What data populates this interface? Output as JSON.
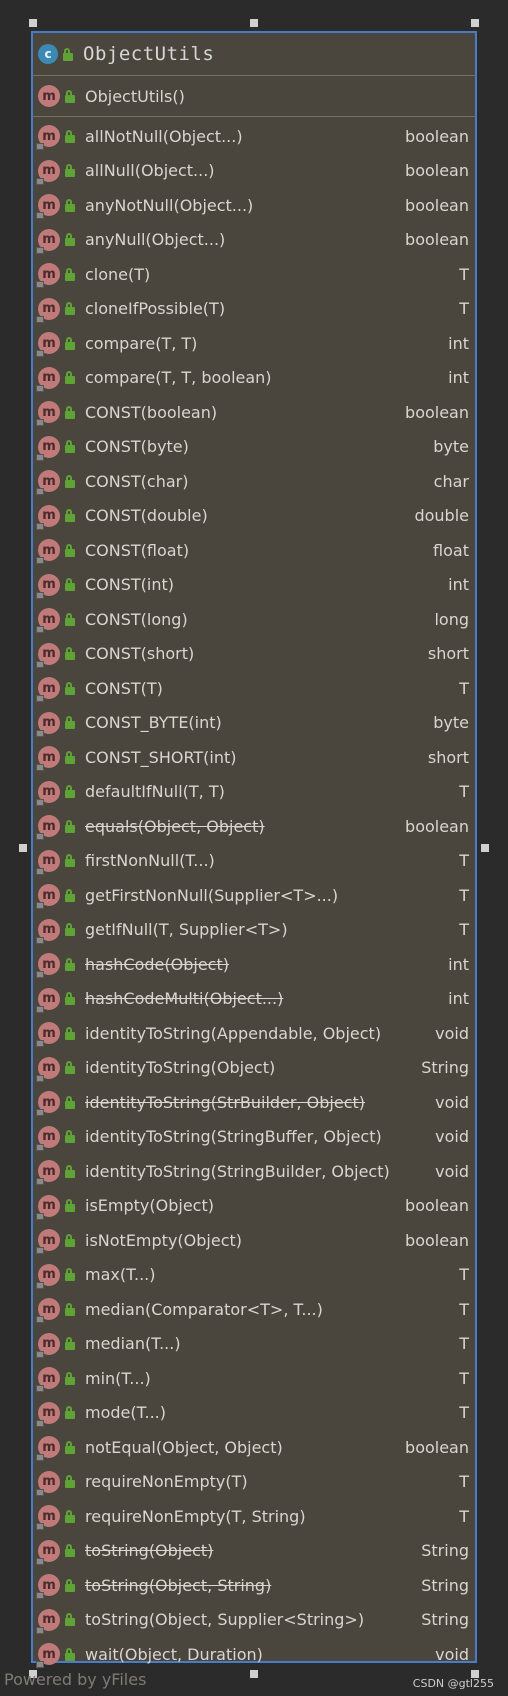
{
  "class_name": "ObjectUtils",
  "class_icon_letter": "c",
  "method_icon_letter": "m",
  "constructor": "ObjectUtils()",
  "methods": [
    {
      "name": "allNotNull(Object...)",
      "ret": "boolean",
      "deprecated": false
    },
    {
      "name": "allNull(Object...)",
      "ret": "boolean",
      "deprecated": false
    },
    {
      "name": "anyNotNull(Object...)",
      "ret": "boolean",
      "deprecated": false
    },
    {
      "name": "anyNull(Object...)",
      "ret": "boolean",
      "deprecated": false
    },
    {
      "name": "clone(T)",
      "ret": "T",
      "deprecated": false
    },
    {
      "name": "cloneIfPossible(T)",
      "ret": "T",
      "deprecated": false
    },
    {
      "name": "compare(T, T)",
      "ret": "int",
      "deprecated": false
    },
    {
      "name": "compare(T, T, boolean)",
      "ret": "int",
      "deprecated": false
    },
    {
      "name": "CONST(boolean)",
      "ret": "boolean",
      "deprecated": false
    },
    {
      "name": "CONST(byte)",
      "ret": "byte",
      "deprecated": false
    },
    {
      "name": "CONST(char)",
      "ret": "char",
      "deprecated": false
    },
    {
      "name": "CONST(double)",
      "ret": "double",
      "deprecated": false
    },
    {
      "name": "CONST(float)",
      "ret": "float",
      "deprecated": false
    },
    {
      "name": "CONST(int)",
      "ret": "int",
      "deprecated": false
    },
    {
      "name": "CONST(long)",
      "ret": "long",
      "deprecated": false
    },
    {
      "name": "CONST(short)",
      "ret": "short",
      "deprecated": false
    },
    {
      "name": "CONST(T)",
      "ret": "T",
      "deprecated": false
    },
    {
      "name": "CONST_BYTE(int)",
      "ret": "byte",
      "deprecated": false
    },
    {
      "name": "CONST_SHORT(int)",
      "ret": "short",
      "deprecated": false
    },
    {
      "name": "defaultIfNull(T, T)",
      "ret": "T",
      "deprecated": false
    },
    {
      "name": "equals(Object, Object)",
      "ret": "boolean",
      "deprecated": true
    },
    {
      "name": "firstNonNull(T...)",
      "ret": "T",
      "deprecated": false
    },
    {
      "name": "getFirstNonNull(Supplier<T>...)",
      "ret": "T",
      "deprecated": false
    },
    {
      "name": "getIfNull(T, Supplier<T>)",
      "ret": "T",
      "deprecated": false
    },
    {
      "name": "hashCode(Object)",
      "ret": "int",
      "deprecated": true
    },
    {
      "name": "hashCodeMulti(Object...)",
      "ret": "int",
      "deprecated": true
    },
    {
      "name": "identityToString(Appendable, Object)",
      "ret": "void",
      "deprecated": false
    },
    {
      "name": "identityToString(Object)",
      "ret": "String",
      "deprecated": false
    },
    {
      "name": "identityToString(StrBuilder, Object)",
      "ret": "void",
      "deprecated": true
    },
    {
      "name": "identityToString(StringBuffer, Object)",
      "ret": "void",
      "deprecated": false
    },
    {
      "name": "identityToString(StringBuilder, Object)",
      "ret": "void",
      "deprecated": false
    },
    {
      "name": "isEmpty(Object)",
      "ret": "boolean",
      "deprecated": false
    },
    {
      "name": "isNotEmpty(Object)",
      "ret": "boolean",
      "deprecated": false
    },
    {
      "name": "max(T...)",
      "ret": "T",
      "deprecated": false
    },
    {
      "name": "median(Comparator<T>, T...)",
      "ret": "T",
      "deprecated": false
    },
    {
      "name": "median(T...)",
      "ret": "T",
      "deprecated": false
    },
    {
      "name": "min(T...)",
      "ret": "T",
      "deprecated": false
    },
    {
      "name": "mode(T...)",
      "ret": "T",
      "deprecated": false
    },
    {
      "name": "notEqual(Object, Object)",
      "ret": "boolean",
      "deprecated": false
    },
    {
      "name": "requireNonEmpty(T)",
      "ret": "T",
      "deprecated": false
    },
    {
      "name": "requireNonEmpty(T, String)",
      "ret": "T",
      "deprecated": false
    },
    {
      "name": "toString(Object)",
      "ret": "String",
      "deprecated": true
    },
    {
      "name": "toString(Object, String)",
      "ret": "String",
      "deprecated": true
    },
    {
      "name": "toString(Object, Supplier<String>)",
      "ret": "String",
      "deprecated": false
    },
    {
      "name": "wait(Object, Duration)",
      "ret": "void",
      "deprecated": false
    }
  ],
  "watermark": "Powered by yFiles",
  "credit": "CSDN @gtl255",
  "colors": {
    "panel_bg": "#4a463d",
    "selection_border": "#4a7bc8",
    "method_icon": "#c07a7a",
    "class_icon": "#3b8ab3",
    "public_lock": "#5fa336",
    "text": "#d9d6cf"
  }
}
